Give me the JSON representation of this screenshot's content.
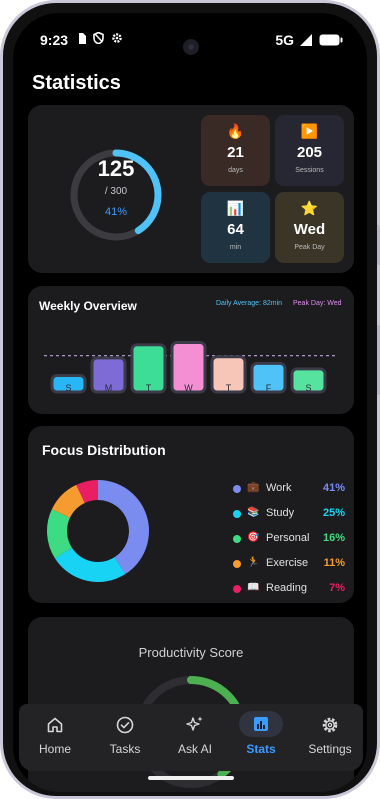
{
  "status_bar": {
    "time": "9:23",
    "network": "5G",
    "left_icons": [
      "sim-card-icon",
      "shield-icon",
      "gear-icon"
    ],
    "right_icons": [
      "signal-icon",
      "battery-icon"
    ]
  },
  "page": {
    "title": "Statistics"
  },
  "progress_ring": {
    "value": "125",
    "goal": "/ 300",
    "percent_label": "41%",
    "fraction": 0.41,
    "accent": "#4fc3f7"
  },
  "stat_tiles": [
    {
      "icon": "🔥",
      "icon_name": "fire-icon",
      "value": "21",
      "label": "days",
      "bg": "#3a2a26"
    },
    {
      "icon": "▶️",
      "icon_name": "play-icon",
      "value": "205",
      "label": "Sessions",
      "bg": "#262733"
    },
    {
      "icon": "📊",
      "icon_name": "bar-chart-icon",
      "value": "64",
      "label": "min",
      "bg": "#1f3340"
    },
    {
      "icon": "⭐",
      "icon_name": "star-icon",
      "value": "Wed",
      "label": "Peak Day",
      "bg": "#3a3526"
    }
  ],
  "weekly": {
    "title": "Weekly Overview",
    "average_label": "Daily Average: 82min",
    "peak_label": "Peak Day: Wed"
  },
  "chart_data": {
    "type": "bar",
    "categories": [
      "S",
      "M",
      "T",
      "W",
      "T",
      "F",
      "S"
    ],
    "values": [
      15,
      31,
      43,
      45,
      32,
      26,
      21
    ],
    "colors": [
      "#29b6f6",
      "#7e6bd6",
      "#3ddc97",
      "#f48fd4",
      "#f8c6b8",
      "#4fc3f7",
      "#56e39f"
    ],
    "average_line": 33,
    "ylim": [
      0,
      50
    ]
  },
  "focus": {
    "title": "Focus Distribution",
    "items": [
      {
        "name": "Work",
        "percent": "41%",
        "value": 41,
        "color": "#7b8cf0",
        "icon": "💼",
        "icon_name": "briefcase-icon"
      },
      {
        "name": "Study",
        "percent": "25%",
        "value": 25,
        "color": "#19d3f5",
        "icon": "📚",
        "icon_name": "books-icon"
      },
      {
        "name": "Personal",
        "percent": "16%",
        "value": 16,
        "color": "#3ddc84",
        "icon": "🎯",
        "icon_name": "target-icon"
      },
      {
        "name": "Exercise",
        "percent": "11%",
        "value": 11,
        "color": "#f59b2f",
        "icon": "🏃",
        "icon_name": "runner-icon"
      },
      {
        "name": "Reading",
        "percent": "7%",
        "value": 7,
        "color": "#e91e63",
        "icon": "📖",
        "icon_name": "book-icon"
      }
    ]
  },
  "productivity": {
    "title": "Productivity Score",
    "fraction": 0.4,
    "accent": "#4caf50"
  },
  "nav": [
    {
      "label": "Home",
      "icon_name": "home-icon",
      "active": false
    },
    {
      "label": "Tasks",
      "icon_name": "check-circle-icon",
      "active": false
    },
    {
      "label": "Ask AI",
      "icon_name": "sparkle-icon",
      "active": false
    },
    {
      "label": "Stats",
      "icon_name": "stats-icon",
      "active": true
    },
    {
      "label": "Settings",
      "icon_name": "settings-icon",
      "active": false
    }
  ]
}
